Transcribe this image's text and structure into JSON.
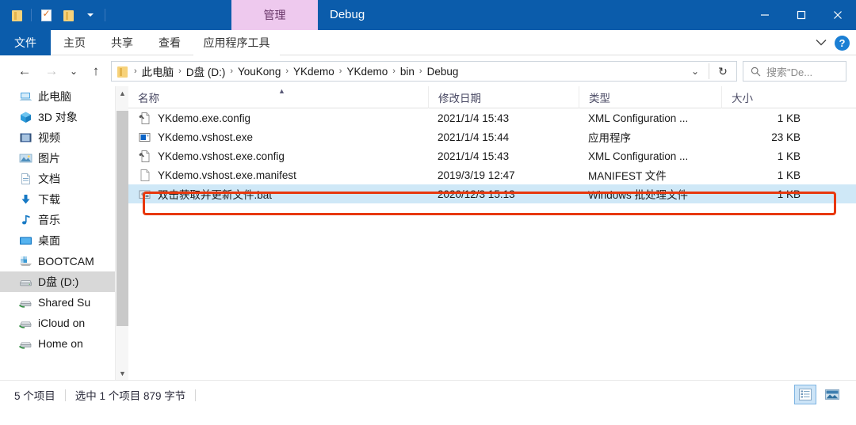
{
  "window": {
    "title": "Debug",
    "contextual_tab": "管理",
    "accent_color": "#0b5cab",
    "contextual_tab_color": "#eec9ee",
    "selection_color": "#cfe8f7",
    "highlight_color": "#e8380d"
  },
  "quick_access": [
    {
      "name": "folder-icon",
      "label": "属性"
    },
    {
      "name": "properties-icon",
      "label": "属性"
    },
    {
      "name": "new-folder-icon",
      "label": "新建文件夹"
    },
    {
      "name": "chevron-down-icon",
      "label": "自定义快速访问工具栏"
    }
  ],
  "window_controls": {
    "minimize": "最小化",
    "maximize": "最大化",
    "close": "关闭"
  },
  "ribbon": {
    "tabs": [
      {
        "label": "文件",
        "type": "file"
      },
      {
        "label": "主页",
        "type": "normal"
      },
      {
        "label": "共享",
        "type": "normal"
      },
      {
        "label": "查看",
        "type": "normal"
      },
      {
        "label": "应用程序工具",
        "type": "contextual"
      }
    ],
    "collapse_label": "展开功能区",
    "help_label": "?"
  },
  "address_bar": {
    "back": "←",
    "forward": "→",
    "recent": "⌄",
    "up": "↑",
    "crumbs": [
      "此电脑",
      "D盘 (D:)",
      "YouKong",
      "YKdemo",
      "YKdemo",
      "bin",
      "Debug"
    ],
    "separator": "›",
    "dropdown": "⌄",
    "refresh": "↻"
  },
  "search": {
    "placeholder": "搜索\"De...",
    "icon": "search-icon"
  },
  "sidebar": {
    "items": [
      {
        "label": "此电脑",
        "icon": "computer-icon",
        "selected": false
      },
      {
        "label": "3D 对象",
        "icon": "3d-objects-icon",
        "selected": false
      },
      {
        "label": "视频",
        "icon": "videos-icon",
        "selected": false
      },
      {
        "label": "图片",
        "icon": "pictures-icon",
        "selected": false
      },
      {
        "label": "文档",
        "icon": "documents-icon",
        "selected": false
      },
      {
        "label": "下载",
        "icon": "downloads-icon",
        "selected": false
      },
      {
        "label": "音乐",
        "icon": "music-icon",
        "selected": false
      },
      {
        "label": "桌面",
        "icon": "desktop-icon",
        "selected": false
      },
      {
        "label": "BOOTCAM",
        "icon": "drive-icon",
        "selected": false
      },
      {
        "label": "D盘 (D:)",
        "icon": "hdd-icon",
        "selected": true
      },
      {
        "label": "Shared Su",
        "icon": "network-drive-icon",
        "selected": false
      },
      {
        "label": "iCloud on",
        "icon": "network-drive-icon",
        "selected": false
      },
      {
        "label": "Home on",
        "icon": "network-drive-icon",
        "selected": false
      }
    ]
  },
  "file_list": {
    "columns": [
      {
        "label": "名称",
        "sorted": true,
        "sort_dir": "asc"
      },
      {
        "label": "修改日期",
        "sorted": false
      },
      {
        "label": "类型",
        "sorted": false
      },
      {
        "label": "大小",
        "sorted": false
      }
    ],
    "rows": [
      {
        "name": "YKdemo.exe.config",
        "date": "2021/1/4 15:43",
        "type": "XML Configuration ...",
        "size": "1 KB",
        "icon": "xml-config-icon",
        "selected": false
      },
      {
        "name": "YKdemo.vshost.exe",
        "date": "2021/1/4 15:44",
        "type": "应用程序",
        "size": "23 KB",
        "icon": "application-icon",
        "selected": false
      },
      {
        "name": "YKdemo.vshost.exe.config",
        "date": "2021/1/4 15:43",
        "type": "XML Configuration ...",
        "size": "1 KB",
        "icon": "xml-config-icon",
        "selected": false
      },
      {
        "name": "YKdemo.vshost.exe.manifest",
        "date": "2019/3/19 12:47",
        "type": "MANIFEST 文件",
        "size": "1 KB",
        "icon": "blank-file-icon",
        "selected": false
      },
      {
        "name": "双击获取并更新文件.bat",
        "date": "2020/12/3 15:13",
        "type": "Windows 批处理文件",
        "size": "1 KB",
        "icon": "batch-file-icon",
        "selected": true
      }
    ]
  },
  "status_bar": {
    "item_count": "5 个项目",
    "selection_info": "选中 1 个项目  879 字节",
    "views": [
      {
        "name": "details-view",
        "label": "详细信息",
        "active": true
      },
      {
        "name": "large-icons-view",
        "label": "大图标",
        "active": false
      }
    ]
  }
}
